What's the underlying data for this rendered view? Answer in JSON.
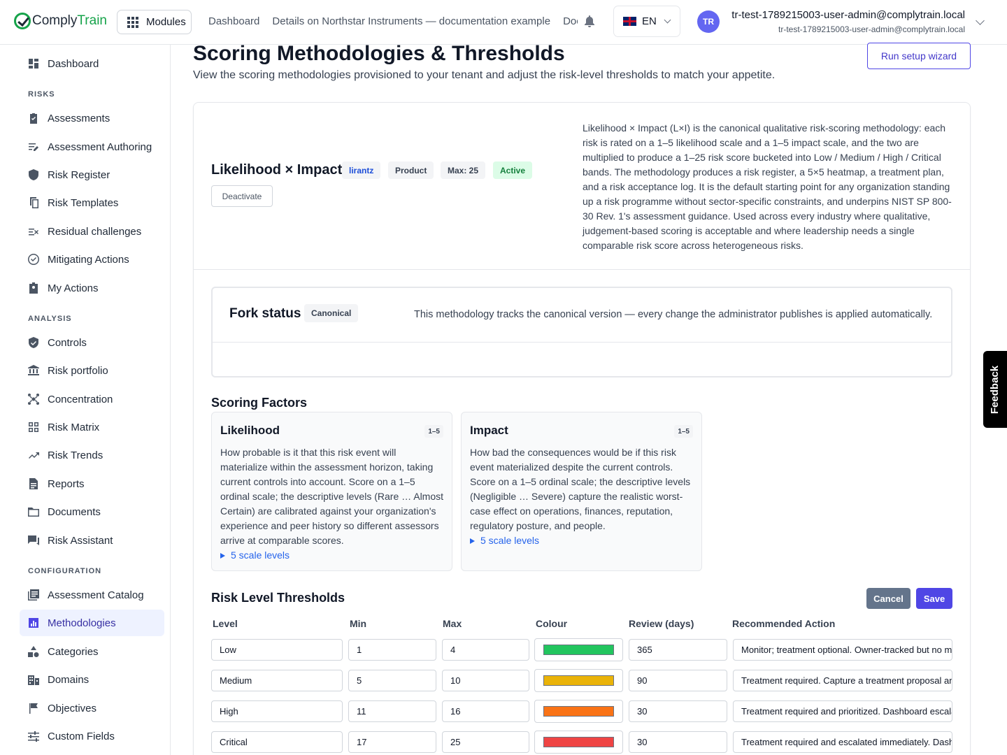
{
  "brand": {
    "name_part1": "Comply",
    "name_part2": "Train"
  },
  "topbar": {
    "modules_label": "Modules",
    "breadcrumbs": [
      "Dashboard",
      "Details on Northstar Instruments — documentation example",
      "Documents"
    ],
    "language": "EN",
    "avatar_initials": "TR",
    "user_name": "tr-test-1789215003-user-admin@complytrain.local",
    "user_email": "tr-test-1789215003-user-admin@complytrain.local"
  },
  "sidebar": {
    "top_item": {
      "label": "Dashboard",
      "icon": "dashboard-icon"
    },
    "sections": [
      {
        "title": "RISKS",
        "items": [
          {
            "label": "Assessments",
            "icon": "clipboard-check-icon"
          },
          {
            "label": "Assessment Authoring",
            "icon": "edit-list-icon"
          },
          {
            "label": "Risk Register",
            "icon": "shield-icon"
          },
          {
            "label": "Risk Templates",
            "icon": "copy-icon"
          },
          {
            "label": "Residual challenges",
            "icon": "list-x-icon"
          },
          {
            "label": "Mitigating Actions",
            "icon": "check-circle-icon"
          },
          {
            "label": "My Actions",
            "icon": "user-badge-icon"
          }
        ]
      },
      {
        "title": "ANALYSIS",
        "items": [
          {
            "label": "Controls",
            "icon": "shield-check-icon"
          },
          {
            "label": "Risk portfolio",
            "icon": "bank-icon"
          },
          {
            "label": "Concentration",
            "icon": "hub-icon"
          },
          {
            "label": "Risk Matrix",
            "icon": "grid-icon"
          },
          {
            "label": "Risk Trends",
            "icon": "trend-icon"
          },
          {
            "label": "Reports",
            "icon": "report-icon"
          },
          {
            "label": "Documents",
            "icon": "folder-icon"
          },
          {
            "label": "Risk Assistant",
            "icon": "chat-icon"
          }
        ]
      },
      {
        "title": "CONFIGURATION",
        "items": [
          {
            "label": "Assessment Catalog",
            "icon": "catalog-icon"
          },
          {
            "label": "Methodologies",
            "icon": "chart-icon",
            "active": true
          },
          {
            "label": "Categories",
            "icon": "shapes-icon"
          },
          {
            "label": "Domains",
            "icon": "building-icon"
          },
          {
            "label": "Objectives",
            "icon": "flag-icon"
          },
          {
            "label": "Custom Fields",
            "icon": "sliders-icon"
          }
        ]
      }
    ]
  },
  "page": {
    "title": "Scoring Methodologies & Thresholds",
    "subtitle": "View the scoring methodologies provisioned to your tenant and adjust the risk-level thresholds to match your appetite.",
    "wizard_button": "Run setup wizard"
  },
  "methodology": {
    "name": "Likelihood × Impact",
    "badges": [
      "lirantz",
      "Product",
      "Max: 25",
      "Active"
    ],
    "deactivate_label": "Deactivate",
    "description": "Likelihood × Impact (L×I) is the canonical qualitative risk-scoring methodology: each risk is rated on a 1–5 likelihood scale and a 1–5 impact scale, and the two are multiplied to produce a 1–25 risk score bucketed into Low / Medium / High / Critical bands. The methodology produces a risk register, a 5×5 heatmap, a treatment plan, and a risk acceptance log. It is the default starting point for any organization standing up a risk programme without sector-specific constraints, and underpins NIST SP 800-30 Rev. 1's assessment guidance. Used across every industry where qualitative, judgement-based scoring is acceptable and where leadership needs a single comparable risk score across heterogeneous risks."
  },
  "fork": {
    "title": "Fork status",
    "badge": "Canonical",
    "text": "This methodology tracks the canonical version — every change the administrator publishes is applied automatically."
  },
  "factors": {
    "title": "Scoring Factors",
    "items": [
      {
        "name": "Likelihood",
        "range": "1–5",
        "description": "How probable is it that this risk event will materialize within the assessment horizon, taking current controls into account. Score on a 1–5 ordinal scale; the descriptive levels (Rare … Almost Certain) are calibrated against your organization's experience and peer history so different assessors arrive at comparable scores.",
        "levels_label": "5 scale levels"
      },
      {
        "name": "Impact",
        "range": "1–5",
        "description": "How bad the consequences would be if this risk event materialized despite the current controls. Score on a 1–5 ordinal scale; the descriptive levels (Negligible … Severe) capture the realistic worst-case effect on operations, finances, reputation, regulatory posture, and people.",
        "levels_label": "5 scale levels"
      }
    ]
  },
  "thresholds": {
    "title": "Risk Level Thresholds",
    "cancel_label": "Cancel",
    "save_label": "Save",
    "headers": [
      "Level",
      "Min",
      "Max",
      "Colour",
      "Review (days)",
      "Recommended Action"
    ],
    "rows": [
      {
        "level": "Low",
        "min": "1",
        "max": "4",
        "colour": "#22c55e",
        "review": "365",
        "action": "Monitor; treatment optional. Owner-tracked but no mandatory treatment plan."
      },
      {
        "level": "Medium",
        "min": "5",
        "max": "10",
        "colour": "#eab308",
        "review": "90",
        "action": "Treatment required. Capture a treatment proposal and owner."
      },
      {
        "level": "High",
        "min": "11",
        "max": "16",
        "colour": "#f97316",
        "review": "30",
        "action": "Treatment required and prioritized. Dashboard escalation."
      },
      {
        "level": "Critical",
        "min": "17",
        "max": "25",
        "colour": "#ef4444",
        "review": "30",
        "action": "Treatment required and escalated immediately. Dashboard alert."
      }
    ]
  },
  "feedback_label": "Feedback"
}
